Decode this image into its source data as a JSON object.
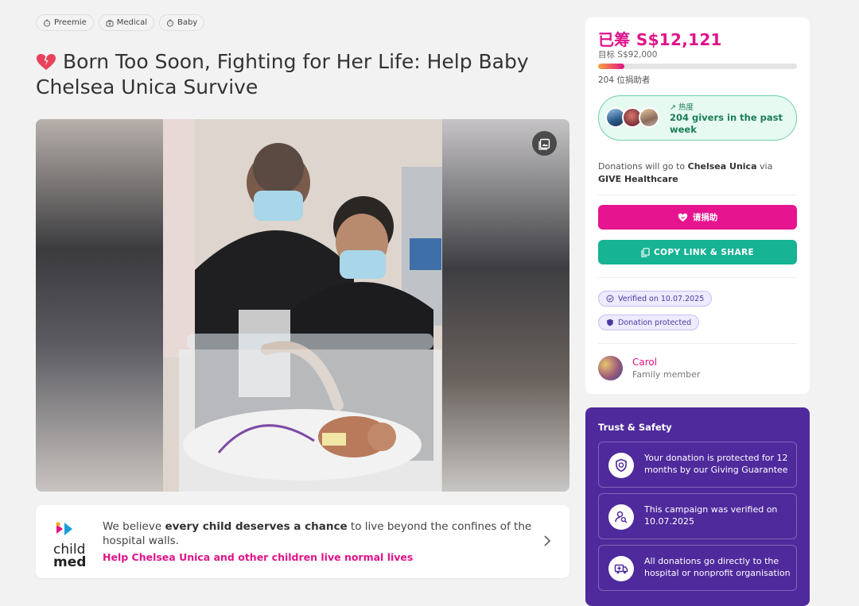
{
  "tags": [
    {
      "label": "Preemie",
      "icon": "baby-face-icon"
    },
    {
      "label": "Medical",
      "icon": "medical-bag-icon"
    },
    {
      "label": "Baby",
      "icon": "baby-face-icon"
    }
  ],
  "campaign": {
    "title": "Born Too Soon, Fighting for Her Life: Help Baby Chelsea Unica Survive",
    "title_icon": "broken-heart-icon"
  },
  "org": {
    "logo_line1": "child",
    "logo_line2": "med",
    "text_pre": "We believe ",
    "text_bold": "every child deserves a chance",
    "text_post": " to live beyond the confines of the hospital walls.",
    "link": "Help Chelsea Unica and other children live normal lives"
  },
  "sidebar": {
    "raised": "已筹 S$12,121",
    "goal": "目标 S$92,000",
    "progress_pct": 13.2,
    "donors": "204 位捐助者",
    "trend_label": "热度",
    "trend_text": "204 givers in the past week",
    "goto_pre": "Donations will go to ",
    "goto_name": "Chelsea Unica",
    "goto_mid": " via ",
    "goto_org": "GIVE Healthcare",
    "donate_label": "请捐助",
    "share_label": "COPY LINK & SHARE",
    "verified_label": "Verified on 10.07.2025",
    "protected_label": "Donation protected",
    "organiser_name": "Carol",
    "organiser_role": "Family member"
  },
  "trust": {
    "title": "Trust & Safety",
    "items": [
      {
        "text": "Your donation is protected for 12 months by our Giving Guarantee",
        "icon": "shield-icon"
      },
      {
        "text": "This campaign was verified on 10.07.2025",
        "icon": "user-search-icon"
      },
      {
        "text": "All donations go directly to the hospital or nonprofit organisation",
        "icon": "ambulance-icon"
      }
    ]
  },
  "colors": {
    "accent_pink": "#e0148a",
    "share_green": "#16b394",
    "trust_purple": "#4f2a9c"
  }
}
